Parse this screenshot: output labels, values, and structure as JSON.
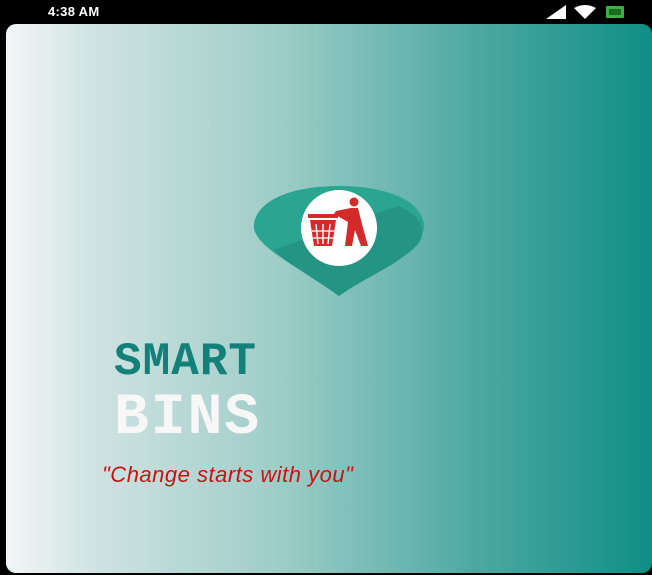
{
  "status_bar": {
    "time": "4:38 AM",
    "icons": [
      "signal-icon",
      "wifi-icon",
      "battery-icon"
    ]
  },
  "splash": {
    "logo_icon": "trash-bin-pin-icon",
    "title_line1": "SMART",
    "title_line2": "BINS",
    "tagline": "\"Change starts with you\""
  },
  "colors": {
    "accent_teal": "#13807a",
    "pin_teal": "#2aa58f",
    "tagline_red": "#cc1111",
    "gradient_end": "#0e8e85"
  }
}
